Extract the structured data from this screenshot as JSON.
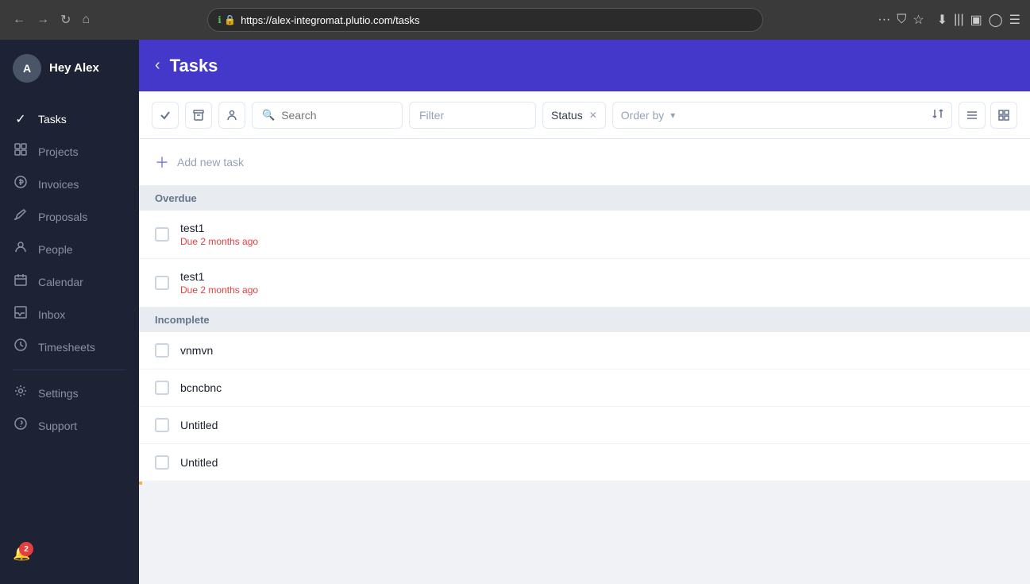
{
  "browser": {
    "url_prefix": "https://alex-integromat.",
    "url_domain": "plutio.com",
    "url_path": "/tasks",
    "url_full": "https://alex-integromat.plutio.com/tasks"
  },
  "sidebar": {
    "user": {
      "initial": "A",
      "greeting": "Hey Alex"
    },
    "items": [
      {
        "id": "tasks",
        "label": "Tasks",
        "icon": "✓",
        "active": true
      },
      {
        "id": "projects",
        "label": "Projects",
        "icon": "◫",
        "active": false
      },
      {
        "id": "invoices",
        "label": "Invoices",
        "icon": "💲",
        "active": false
      },
      {
        "id": "proposals",
        "label": "Proposals",
        "icon": "✏",
        "active": false
      },
      {
        "id": "people",
        "label": "People",
        "icon": "👤",
        "active": false
      },
      {
        "id": "calendar",
        "label": "Calendar",
        "icon": "📅",
        "active": false
      },
      {
        "id": "inbox",
        "label": "Inbox",
        "icon": "✉",
        "active": false
      },
      {
        "id": "timesheets",
        "label": "Timesheets",
        "icon": "⏱",
        "active": false
      },
      {
        "id": "settings",
        "label": "Settings",
        "icon": "⚙",
        "active": false
      },
      {
        "id": "support",
        "label": "Support",
        "icon": "?",
        "active": false
      }
    ],
    "notification_count": "2"
  },
  "header": {
    "title": "Tasks",
    "back_label": "‹"
  },
  "toolbar": {
    "search_placeholder": "Search",
    "filter_placeholder": "Filter",
    "status_label": "Status",
    "order_by_label": "Order by"
  },
  "content": {
    "add_task_label": "Add new task",
    "sections": [
      {
        "id": "overdue",
        "label": "Overdue",
        "tasks": [
          {
            "id": "t1",
            "name": "test1",
            "due": "Due 2 months ago"
          },
          {
            "id": "t2",
            "name": "test1",
            "due": "Due 2 months ago"
          }
        ]
      },
      {
        "id": "incomplete",
        "label": "Incomplete",
        "tasks": [
          {
            "id": "t3",
            "name": "vnmvn",
            "due": ""
          },
          {
            "id": "t4",
            "name": "bcncbnc",
            "due": ""
          },
          {
            "id": "t5",
            "name": "Untitled",
            "due": ""
          },
          {
            "id": "t6",
            "name": "Untitled",
            "due": ""
          }
        ]
      }
    ]
  }
}
